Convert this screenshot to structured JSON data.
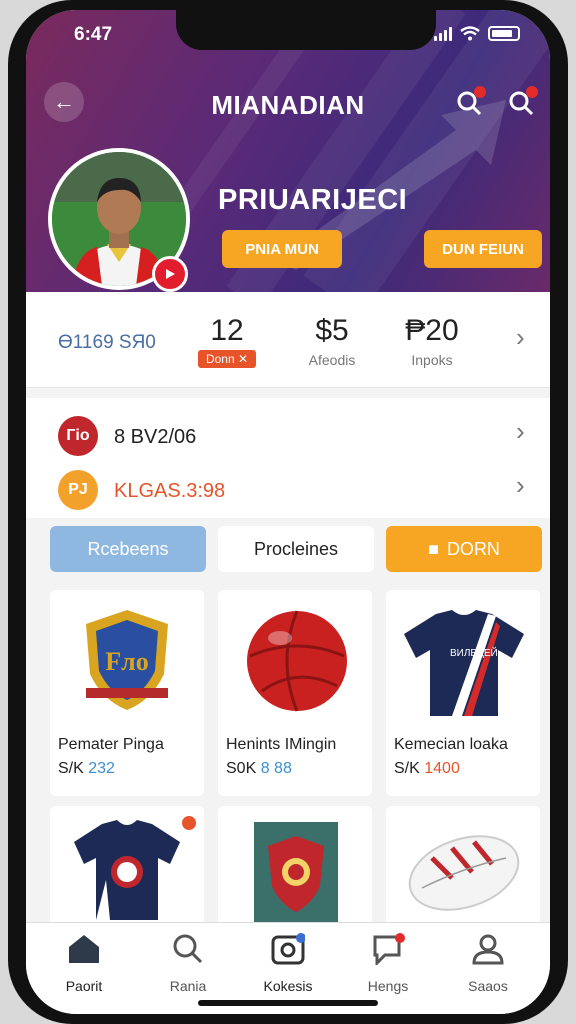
{
  "status_bar": {
    "time": "6:47"
  },
  "header": {
    "title": "MIANADIAN",
    "player_name": "PRIUARIJECI",
    "button_left": "PNIA MUN",
    "button_right": "DUN FEIUN"
  },
  "stats": {
    "id_text": "Ө1169 ЅЯ0",
    "items": [
      {
        "value": "12",
        "tag": "Donn"
      },
      {
        "value": "$5",
        "label": "Afeodis"
      },
      {
        "value": "₱20",
        "label": "Inpoks"
      }
    ]
  },
  "info": [
    {
      "icon_text": "Гіо",
      "text": "8 BV2/06",
      "color": "#c0272d"
    },
    {
      "icon_text": "PJ",
      "text": "KLGAS.3:98",
      "color": "#f2a12a"
    }
  ],
  "tabs": [
    {
      "label": "Rcebeens",
      "state": "blue"
    },
    {
      "label": "Procleines",
      "state": "white"
    },
    {
      "label": "DORN",
      "state": "orange"
    }
  ],
  "products": [
    {
      "name": "Pemater Pinga",
      "price_prefix": "S/K",
      "price": "232",
      "price_color": "#3a8fd0",
      "image": "crest"
    },
    {
      "name": "Henints IMingin",
      "price_prefix": "S0K",
      "price": "8 88",
      "price_color": "#3a8fd0",
      "image": "ball"
    },
    {
      "name": "Kemecian loaka",
      "price_prefix": "S/K",
      "price": "1400",
      "price_color": "#e8542a",
      "image": "jersey"
    },
    {
      "name": "",
      "image": "jersey2"
    },
    {
      "name": "",
      "image": "book"
    },
    {
      "name": "",
      "image": "rugby"
    }
  ],
  "bottom_nav": [
    {
      "label": "Paorit",
      "icon": "home-icon"
    },
    {
      "label": "Rania",
      "icon": "search-icon"
    },
    {
      "label": "Kokesis",
      "icon": "camera-icon"
    },
    {
      "label": "Hengs",
      "icon": "chat-icon"
    },
    {
      "label": "Saaos",
      "icon": "profile-icon"
    }
  ],
  "colors": {
    "accent": "#f6a623",
    "hero_bg": "#5a2a78",
    "tab_blue": "#8fb8e0"
  }
}
